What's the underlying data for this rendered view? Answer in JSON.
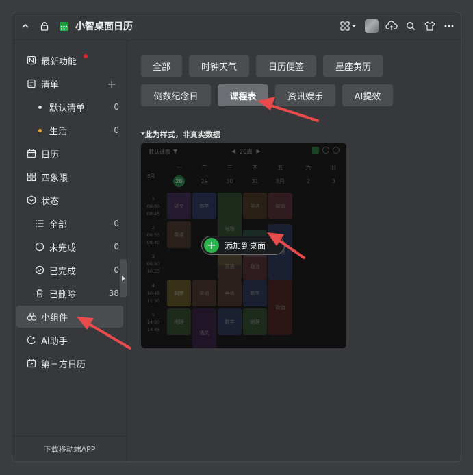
{
  "window": {
    "title": "小智桌面日历"
  },
  "sidebar": {
    "items": [
      {
        "label": "最新功能",
        "icon": "news-icon"
      },
      {
        "label": "清单",
        "icon": "list-icon"
      },
      {
        "label": "默认清单",
        "count": "0"
      },
      {
        "label": "生活",
        "count": "0"
      },
      {
        "label": "日历",
        "icon": "calendar-icon"
      },
      {
        "label": "四象限",
        "icon": "quadrant-icon"
      },
      {
        "label": "状态",
        "icon": "status-icon"
      },
      {
        "label": "全部",
        "count": "0"
      },
      {
        "label": "未完成",
        "count": "0"
      },
      {
        "label": "已完成",
        "count": "0"
      },
      {
        "label": "已删除",
        "count": "38"
      },
      {
        "label": "小组件",
        "icon": "widget-icon"
      },
      {
        "label": "AI助手",
        "icon": "ai-assistant-icon"
      },
      {
        "label": "第三方日历",
        "icon": "third-party-calendar-icon"
      }
    ],
    "footer": "下载移动端APP"
  },
  "widgets": {
    "categories": [
      "全部",
      "时钟天气",
      "日历便签",
      "星座黄历",
      "倒数纪念日",
      "课程表",
      "资讯娱乐",
      "AI提效"
    ],
    "selected": "课程表",
    "note": "*此为样式，非真实数据",
    "add_label": "添加到桌面"
  },
  "preview": {
    "selector": "默认课表",
    "week": "20周",
    "month": "8月",
    "weekdays": [
      "一",
      "二",
      "三",
      "四",
      "五",
      "六",
      "日"
    ],
    "dates": [
      "28",
      "29",
      "30",
      "31",
      "8月",
      "2",
      "3"
    ],
    "periods": [
      {
        "n": "1",
        "s": "08:00",
        "e": "08:45"
      },
      {
        "n": "2",
        "s": "08:55",
        "e": "09:40"
      },
      {
        "n": "3",
        "s": "09:50",
        "e": "10:35"
      },
      {
        "n": "4",
        "s": "10:45",
        "e": "11:30"
      },
      {
        "n": "5",
        "s": "14:00",
        "e": "14:45"
      },
      {
        "n": "6",
        "s": "",
        "e": ""
      }
    ],
    "subjects": [
      "语文",
      "数学",
      "英语",
      "政治",
      "地理",
      "英语",
      "物理",
      "英语",
      "政治",
      "物理",
      "英语",
      "化学",
      "英语",
      "英语",
      "数学",
      "政治",
      "地理",
      "语文",
      "数学",
      "地理"
    ]
  },
  "colors": {
    "accent": "#2bb24c",
    "arrow": "#e84b4b",
    "selected_chip": "#6b6e72",
    "chip": "#4b4d51"
  }
}
